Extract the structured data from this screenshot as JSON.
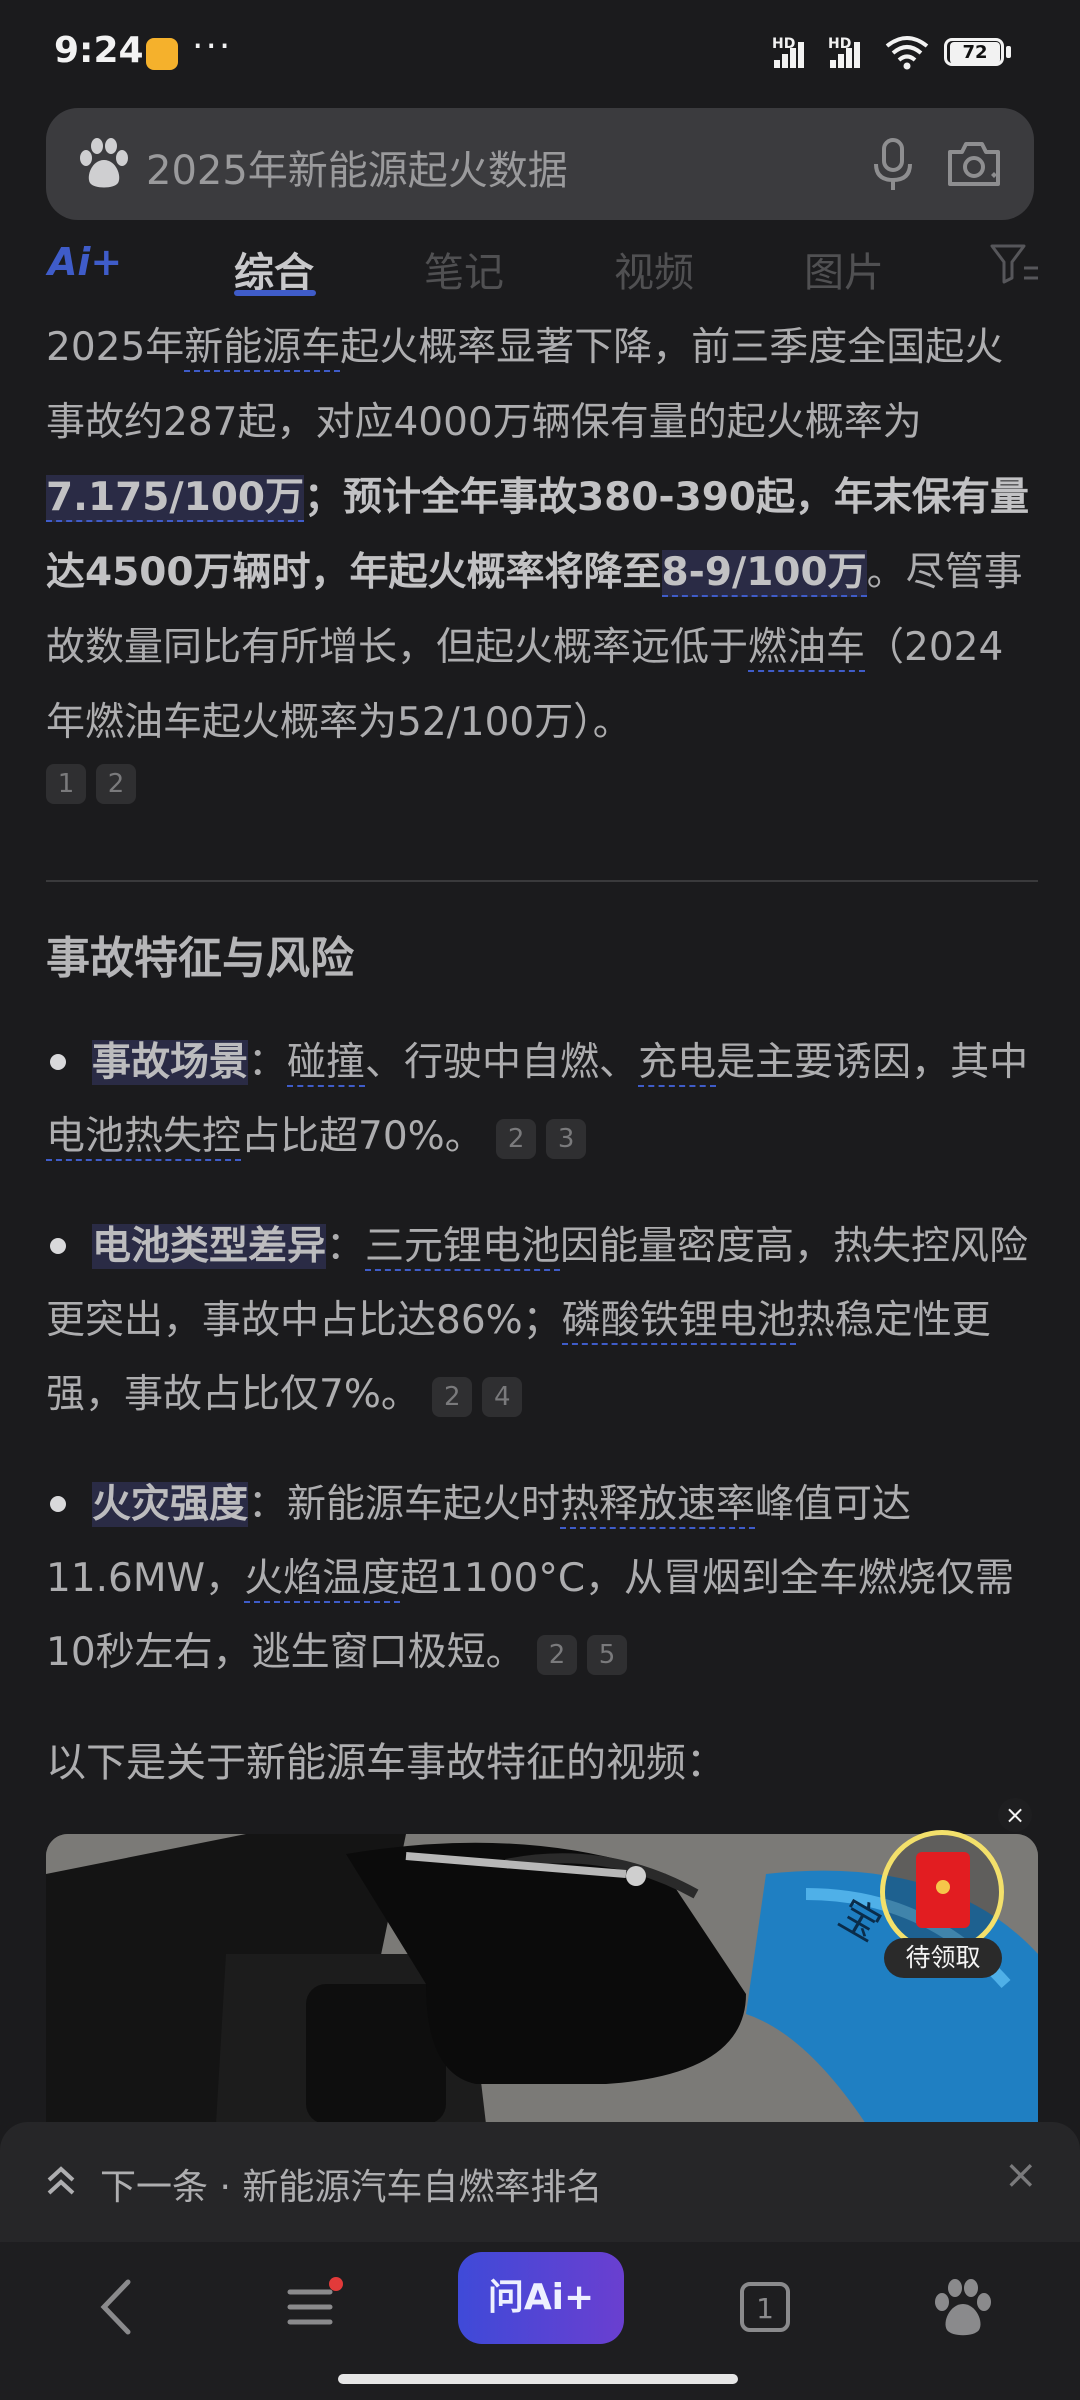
{
  "status_bar": {
    "time": "9:24",
    "signal1": "HD",
    "signal2": "HD",
    "battery": "72"
  },
  "search": {
    "query": "2025年新能源起火数据"
  },
  "tabs": {
    "ai_label": "Ai+",
    "items": [
      "综合",
      "笔记",
      "视频",
      "图片"
    ],
    "active": "综合"
  },
  "summary": {
    "p1a": "2025年",
    "p1b": "新能源车",
    "p1c": "起火概率显著下降，前三季度全国起火事故约287起，对应4000万辆保有量的起火概率为",
    "p1d": "7.175/100万",
    "p1e": "；预计全年事故380-390起，年末保有量达4500万辆时，年起火概率将降至",
    "p1f": "8-9/100万",
    "p1g": "。尽管事故数量同比有所增长，但起火概率远低于",
    "p1h": "燃油车",
    "p1i": "（2024年燃油车起火概率为52/100万）。",
    "cites": [
      "1",
      "2"
    ]
  },
  "section": {
    "title": "事故特征与风险"
  },
  "bullets": [
    {
      "key": "事故场景",
      "parts": [
        "：",
        "碰撞",
        "、行驶中自燃、",
        "充电",
        "是主要诱因，其中",
        "电池热失控",
        "占比超70%。"
      ],
      "cites": [
        "2",
        "3"
      ]
    },
    {
      "key": "电池类型差异",
      "parts": [
        "：",
        "三元锂电池",
        "因能量密度高，热失控风险更突出，事故中占比达86%；",
        "磷酸铁锂电池",
        "热稳定性更强，事故占比仅7%。"
      ],
      "cites": [
        "2",
        "4"
      ]
    },
    {
      "key": "火灾强度",
      "parts": [
        "：新能源车起火时",
        "热释放速率",
        "峰值可达11.6MW，",
        "火焰温度",
        "超1100°C，从冒烟到全车燃烧仅需10秒左右，逃生窗口极短。"
      ],
      "cites": [
        "2",
        "5"
      ]
    }
  ],
  "video": {
    "intro": "以下是关于新能源车事故特征的视频：",
    "close": "×",
    "redpack_label": "待领取"
  },
  "next_bar": {
    "text": "下一条 · 新能源汽车自燃率排名",
    "close": "×"
  },
  "bottom_nav": {
    "ask_ai": "问Ai+",
    "tab_count": "1"
  },
  "colors": {
    "accent": "#3f5cc9",
    "background": "#1b1b1d"
  }
}
